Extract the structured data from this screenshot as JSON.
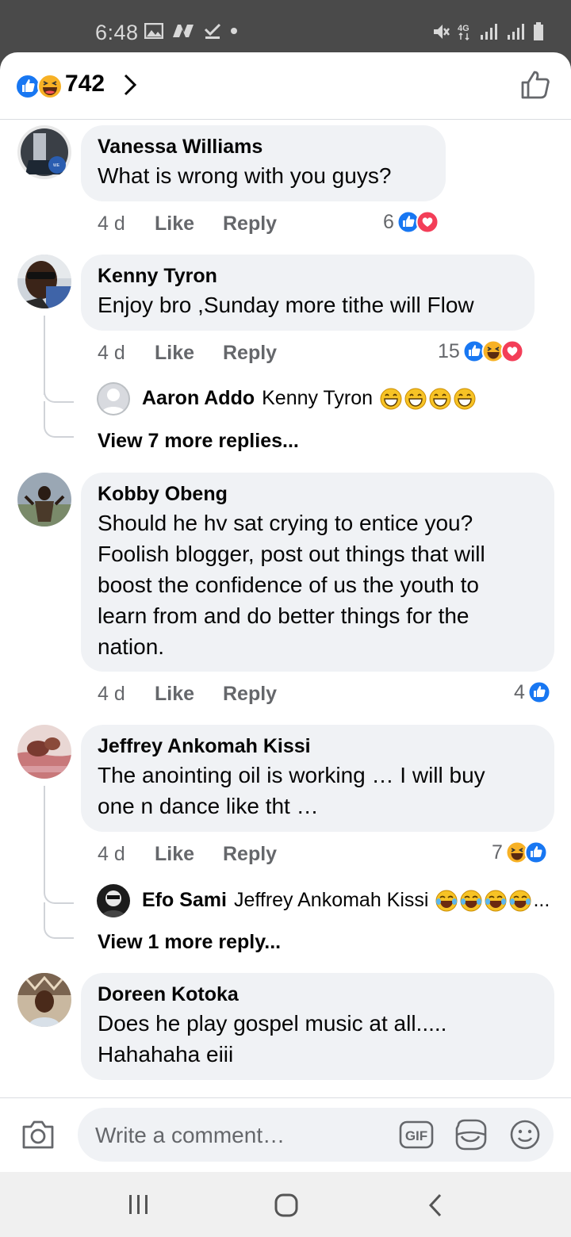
{
  "status_bar": {
    "time": "6:48",
    "network": "4G"
  },
  "header": {
    "reaction_count": "742"
  },
  "comments": [
    {
      "name": "Vanessa Williams",
      "text": "What is wrong with you guys?",
      "time": "4 d",
      "like": "Like",
      "reply": "Reply",
      "reaction_count": "6"
    },
    {
      "name": "Kenny Tyron",
      "text": "Enjoy bro ,Sunday more tithe will Flow",
      "time": "4 d",
      "like": "Like",
      "reply": "Reply",
      "reaction_count": "15",
      "reply_preview": {
        "name": "Aaron Addo",
        "text": "Kenny Tyron"
      },
      "view_more": "View 7 more replies..."
    },
    {
      "name": "Kobby Obeng",
      "text_lines": [
        "Should he hv sat crying to entice you?",
        "Foolish blogger, post out things that will",
        "boost the confidence of us the youth to",
        "learn from and do better things for the",
        "nation."
      ],
      "time": "4 d",
      "like": "Like",
      "reply": "Reply",
      "reaction_count": "4"
    },
    {
      "name": "Jeffrey Ankomah Kissi",
      "text_lines": [
        "The anointing oil is working … I will buy",
        "one n dance like tht …"
      ],
      "time": "4 d",
      "like": "Like",
      "reply": "Reply",
      "reaction_count": "7",
      "reply_preview": {
        "name": "Efo Sami",
        "text": "Jeffrey Ankomah Kissi",
        "ellipsis": "..."
      },
      "view_more": "View 1 more reply..."
    },
    {
      "name": "Doreen Kotoka",
      "text_lines": [
        "Does he play gospel music at all.....",
        "Hahahaha eiii"
      ]
    }
  ],
  "composer": {
    "placeholder": "Write a comment…",
    "gif_label": "GIF"
  },
  "colors": {
    "like_blue": "#1877f2",
    "love_red": "#f33e58",
    "haha_yellow": "#f7b125",
    "bubble_bg": "#f0f2f5"
  }
}
